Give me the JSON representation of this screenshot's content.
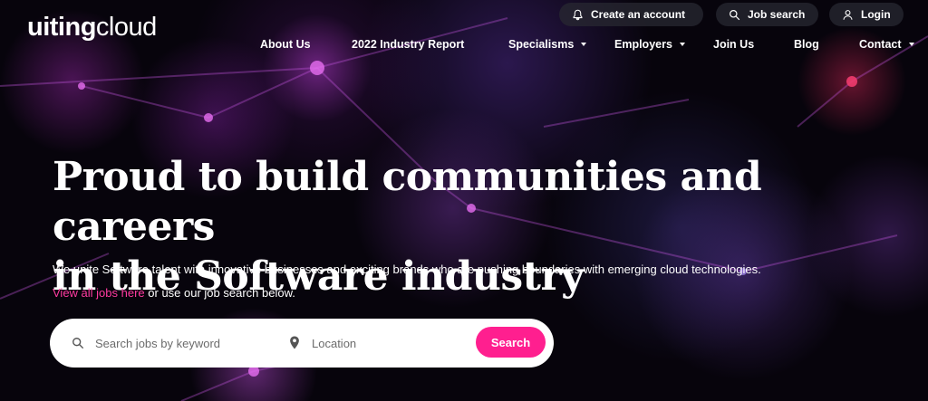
{
  "brand": {
    "logo_bold": "uiting",
    "logo_thin": "cloud"
  },
  "util_nav": {
    "create_account": "Create an account",
    "job_search": "Job search",
    "login": "Login"
  },
  "main_nav": {
    "about": "About Us",
    "report": "2022 Industry Report",
    "specialisms": "Specialisms",
    "employers": "Employers",
    "join": "Join Us",
    "blog": "Blog",
    "contact": "Contact"
  },
  "hero": {
    "headline_line1": "Proud to build communities and careers",
    "headline_line2": "in the Software industry",
    "subtitle": "We unite Software talent with innovative businesses and exciting brands who are pushing boundaries with emerging cloud technologies.",
    "link_text": "View all jobs here",
    "link_suffix": " or use our job search below."
  },
  "search": {
    "keyword_placeholder": "Search jobs by keyword",
    "location_placeholder": "Location",
    "button_label": "Search"
  },
  "colors": {
    "accent": "#ff1f8f",
    "link": "#ff3ba0",
    "background": "#07040c"
  }
}
